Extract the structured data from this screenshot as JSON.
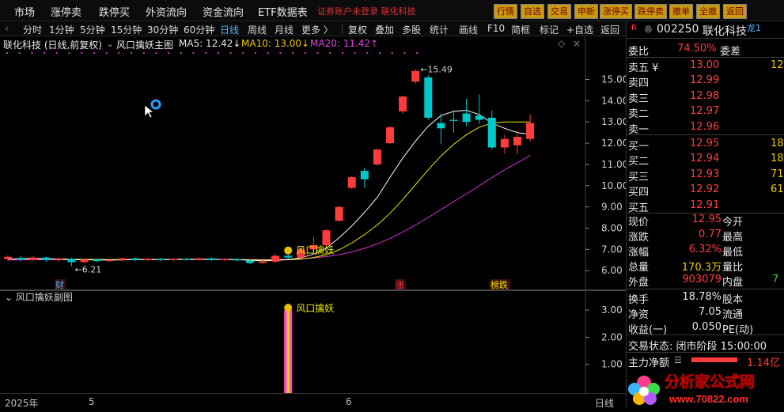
{
  "menu": {
    "items": [
      "市场",
      "涨停卖",
      "跌停买",
      "外资流向",
      "资金流向",
      "ETF数据表"
    ],
    "login_note": "证券账户未登录  联化科技",
    "quick_buttons": [
      "行情",
      "自选",
      "交易",
      "申新",
      "涨停买",
      "跌停卖",
      "撤单",
      "全撤",
      "返回"
    ]
  },
  "toolbar": {
    "periods": [
      "分时",
      "1分钟",
      "5分钟",
      "15分钟",
      "30分钟",
      "60分钟",
      "日线",
      "周线",
      "月线",
      "更多 〉"
    ],
    "active_period": "日线",
    "tools": [
      "复权",
      "叠加",
      "多股",
      "统计",
      "画线",
      "F10",
      "简框",
      "标记",
      "+自选",
      "返回"
    ]
  },
  "chart_info": {
    "stock": "联化科技 (日线,前复权)",
    "indicator": "风口擒妖主图",
    "ma5": "MA5: 12.42↓",
    "ma10": "MA10: 13.00↓",
    "ma20": "MA20: 11.42↑"
  },
  "sub_chart": {
    "title": "风口擒妖副图",
    "signal_label": "风口擒妖"
  },
  "markers": {
    "cai": "财",
    "zhang": "涨",
    "bang": "榜跌",
    "main_signal": "风口擒妖"
  },
  "time_axis": {
    "year": "2025年",
    "m5": "5",
    "m6": "6",
    "period": "日线"
  },
  "colors": {
    "up": "#ff3c3c",
    "down": "#00c8c8",
    "ma5": "#ffffff",
    "ma10": "#e6e600",
    "ma20": "#d030d0",
    "bg": "#000000"
  },
  "chart_data": {
    "type": "candlestick",
    "y_ticks": [
      15.0,
      14.0,
      13.0,
      12.0,
      11.0,
      10.0,
      9.0,
      8.0,
      7.0,
      6.0
    ],
    "ylim": [
      5.45,
      15.95
    ],
    "high_label": "15.49",
    "low_label": "6.21",
    "candles": [
      {
        "o": 6.55,
        "c": 6.65,
        "h": 6.72,
        "l": 6.45
      },
      {
        "o": 6.6,
        "c": 6.52,
        "h": 6.68,
        "l": 6.45
      },
      {
        "o": 6.52,
        "c": 6.62,
        "h": 6.7,
        "l": 6.48
      },
      {
        "o": 6.62,
        "c": 6.5,
        "h": 6.66,
        "l": 6.42
      },
      {
        "o": 6.5,
        "c": 6.55,
        "h": 6.62,
        "l": 6.4
      },
      {
        "o": 6.55,
        "c": 6.4,
        "h": 6.6,
        "l": 6.21
      },
      {
        "o": 6.4,
        "c": 6.52,
        "h": 6.58,
        "l": 6.35
      },
      {
        "o": 6.52,
        "c": 6.45,
        "h": 6.57,
        "l": 6.4
      },
      {
        "o": 6.45,
        "c": 6.5,
        "h": 6.55,
        "l": 6.4
      },
      {
        "o": 6.5,
        "c": 6.58,
        "h": 6.62,
        "l": 6.45
      },
      {
        "o": 6.58,
        "c": 6.5,
        "h": 6.62,
        "l": 6.45
      },
      {
        "o": 6.5,
        "c": 6.56,
        "h": 6.6,
        "l": 6.46
      },
      {
        "o": 6.56,
        "c": 6.5,
        "h": 6.6,
        "l": 6.45
      },
      {
        "o": 6.5,
        "c": 6.55,
        "h": 6.6,
        "l": 6.46
      },
      {
        "o": 6.55,
        "c": 6.52,
        "h": 6.6,
        "l": 6.48
      },
      {
        "o": 6.52,
        "c": 6.58,
        "h": 6.62,
        "l": 6.48
      },
      {
        "o": 6.58,
        "c": 6.5,
        "h": 6.62,
        "l": 6.46
      },
      {
        "o": 6.5,
        "c": 6.54,
        "h": 6.58,
        "l": 6.46
      },
      {
        "o": 6.54,
        "c": 6.48,
        "h": 6.58,
        "l": 6.44
      },
      {
        "o": 6.48,
        "c": 6.36,
        "h": 6.52,
        "l": 6.3
      },
      {
        "o": 6.36,
        "c": 6.42,
        "h": 6.48,
        "l": 6.32
      },
      {
        "o": 6.42,
        "c": 6.7,
        "h": 6.78,
        "l": 6.38
      },
      {
        "o": 6.7,
        "c": 6.62,
        "h": 6.78,
        "l": 6.55
      },
      {
        "o": 6.62,
        "c": 7.0,
        "h": 7.1,
        "l": 6.58
      },
      {
        "o": 7.0,
        "c": 7.2,
        "h": 7.6,
        "l": 6.95
      },
      {
        "o": 7.2,
        "c": 7.9,
        "h": 7.95,
        "l": 7.15
      },
      {
        "o": 8.35,
        "c": 9.0,
        "h": 9.05,
        "l": 8.3
      },
      {
        "o": 9.9,
        "c": 10.4,
        "h": 10.45,
        "l": 9.85
      },
      {
        "o": 10.7,
        "c": 10.3,
        "h": 10.85,
        "l": 9.9
      },
      {
        "o": 11.0,
        "c": 11.7,
        "h": 11.75,
        "l": 10.95
      },
      {
        "o": 12.0,
        "c": 12.75,
        "h": 12.8,
        "l": 11.95
      },
      {
        "o": 13.5,
        "c": 14.2,
        "h": 14.25,
        "l": 13.4
      },
      {
        "o": 14.9,
        "c": 15.4,
        "h": 15.49,
        "l": 14.8
      },
      {
        "o": 15.1,
        "c": 13.2,
        "h": 15.2,
        "l": 13.1
      },
      {
        "o": 12.95,
        "c": 12.7,
        "h": 13.4,
        "l": 11.95
      },
      {
        "o": 13.1,
        "c": 13.05,
        "h": 13.55,
        "l": 12.5
      },
      {
        "o": 13.4,
        "c": 13.0,
        "h": 14.1,
        "l": 12.8
      },
      {
        "o": 13.3,
        "c": 13.1,
        "h": 14.3,
        "l": 12.9
      },
      {
        "o": 13.2,
        "c": 11.8,
        "h": 13.55,
        "l": 11.7
      },
      {
        "o": 11.8,
        "c": 12.2,
        "h": 12.4,
        "l": 11.5
      },
      {
        "o": 11.9,
        "c": 12.3,
        "h": 12.6,
        "l": 11.5
      },
      {
        "o": 12.2,
        "c": 12.95,
        "h": 13.35,
        "l": 12.1
      }
    ],
    "ma5": [
      6.55,
      6.56,
      6.57,
      6.56,
      6.55,
      6.52,
      6.51,
      6.5,
      6.5,
      6.5,
      6.52,
      6.53,
      6.53,
      6.53,
      6.54,
      6.54,
      6.53,
      6.53,
      6.52,
      6.49,
      6.46,
      6.48,
      6.52,
      6.6,
      6.78,
      7.05,
      7.55,
      8.1,
      8.75,
      9.45,
      10.4,
      11.3,
      12.1,
      12.8,
      13.3,
      13.5,
      13.55,
      13.35,
      12.95,
      12.7,
      12.5,
      12.42
    ],
    "ma10": [
      6.54,
      6.55,
      6.55,
      6.55,
      6.55,
      6.54,
      6.53,
      6.53,
      6.52,
      6.52,
      6.52,
      6.52,
      6.52,
      6.52,
      6.53,
      6.53,
      6.53,
      6.53,
      6.52,
      6.51,
      6.5,
      6.5,
      6.51,
      6.54,
      6.62,
      6.75,
      6.98,
      7.3,
      7.7,
      8.15,
      8.7,
      9.35,
      10.05,
      10.75,
      11.4,
      11.95,
      12.4,
      12.75,
      12.95,
      13.0,
      13.0,
      13.0
    ],
    "ma20": [
      6.5,
      6.5,
      6.51,
      6.51,
      6.51,
      6.51,
      6.51,
      6.52,
      6.52,
      6.52,
      6.52,
      6.52,
      6.52,
      6.52,
      6.52,
      6.52,
      6.52,
      6.52,
      6.52,
      6.52,
      6.52,
      6.53,
      6.54,
      6.56,
      6.6,
      6.66,
      6.75,
      6.88,
      7.05,
      7.26,
      7.52,
      7.82,
      8.15,
      8.5,
      8.88,
      9.25,
      9.62,
      10.0,
      10.38,
      10.75,
      11.08,
      11.42
    ],
    "sub_y_ticks": [
      3.0,
      2.0,
      1.0
    ],
    "sub_ylim": [
      0,
      3.5
    ],
    "sub_signal_index": 22,
    "sub_signal_value": 3.0
  },
  "quote": {
    "code": "002250",
    "name": "联化科技",
    "badge": "R",
    "tag": "龙1",
    "rows": [
      {
        "k": "委比",
        "v": "74.50%",
        "k2": "委差",
        "v2": ""
      },
      {
        "k": "卖五 ¥",
        "v": "13.00",
        "v2": "12"
      },
      {
        "k": "卖四",
        "v": "12.99",
        "v2": ""
      },
      {
        "k": "卖三",
        "v": "12.98",
        "v2": ""
      },
      {
        "k": "卖二",
        "v": "12.97",
        "v2": ""
      },
      {
        "k": "卖一",
        "v": "12.96",
        "v2": ""
      },
      {
        "k": "买一",
        "v": "12.95",
        "v2": "18"
      },
      {
        "k": "买二",
        "v": "12.94",
        "v2": "18"
      },
      {
        "k": "买三",
        "v": "12.93",
        "v2": "71"
      },
      {
        "k": "买四",
        "v": "12.92",
        "v2": "61"
      },
      {
        "k": "买五",
        "v": "12.91",
        "v2": ""
      }
    ],
    "stats": [
      {
        "k": "现价",
        "v": "12.95",
        "k2": "今开"
      },
      {
        "k": "涨跌",
        "v": "0.77",
        "k2": "最高"
      },
      {
        "k": "涨幅",
        "v": "6.32%",
        "k2": "最低"
      },
      {
        "k": "总量",
        "v": "170.3万",
        "k2": "量比"
      },
      {
        "k": "外盘",
        "v": "903079",
        "k2": "内盘",
        "v2": "7"
      }
    ],
    "stats2": [
      {
        "k": "换手",
        "v": "18.78%",
        "k2": "股本"
      },
      {
        "k": "净资",
        "v": "7.05",
        "k2": "流通"
      },
      {
        "k": "收益(一)",
        "v": "0.050",
        "k2": "PE(动)"
      }
    ],
    "trade_state": "交易状态: 闭市阶段 15:00:00",
    "main_flow_label": "主力净额",
    "main_flow_value": "1.14亿"
  },
  "logo": {
    "text": "分析家公式网",
    "url_text": "www.70822.com"
  }
}
